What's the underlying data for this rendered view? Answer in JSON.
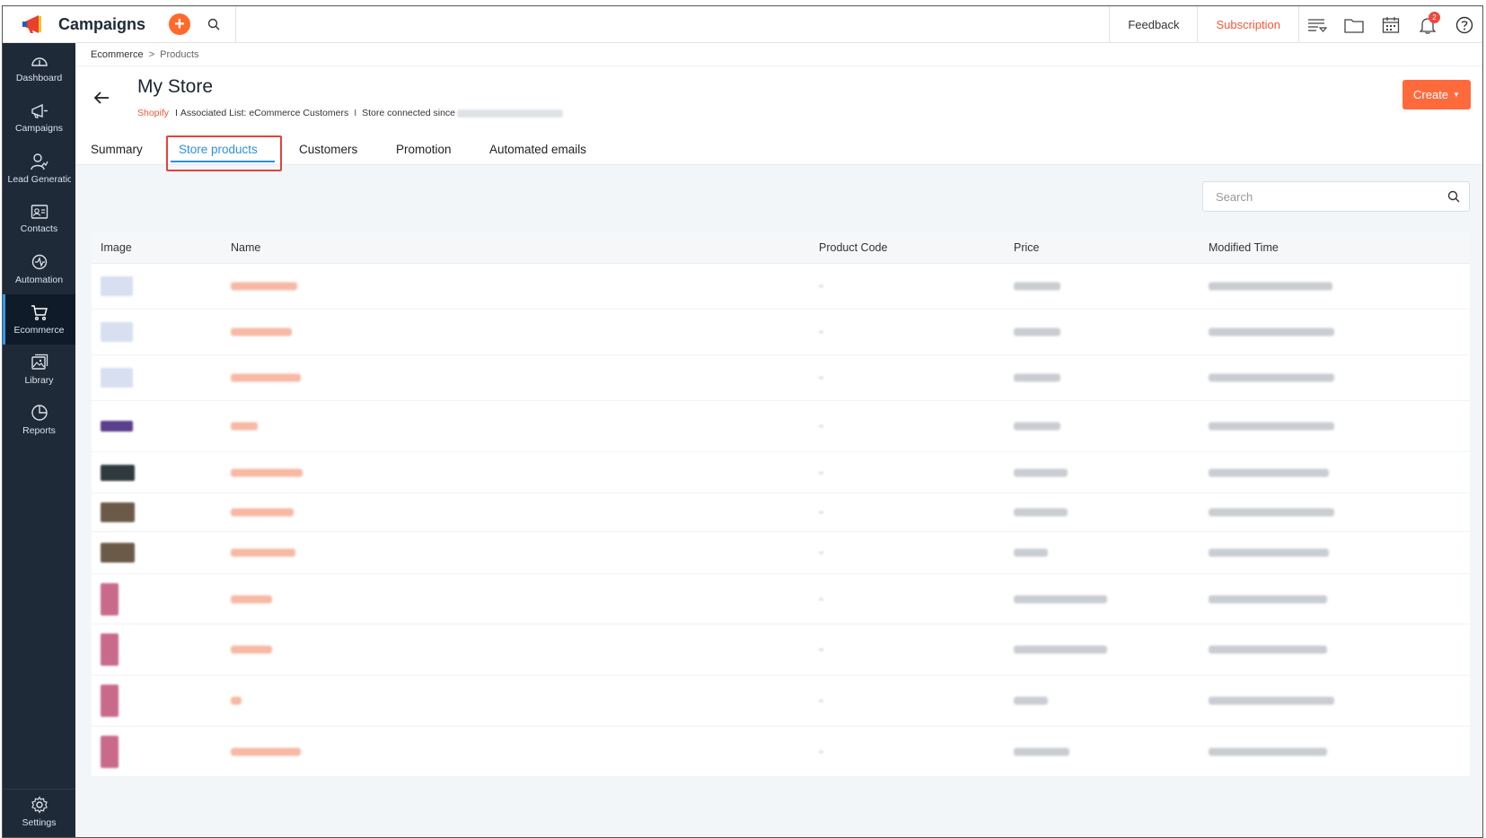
{
  "app": {
    "name": "Campaigns",
    "add_symbol": "+",
    "brand_color": "#e8412e"
  },
  "topbar": {
    "feedback_label": "Feedback",
    "subscription_label": "Subscription",
    "notification_count": "2",
    "icons": [
      "search-icon",
      "list-filter-icon",
      "folder-icon",
      "calendar-icon",
      "bell-icon",
      "help-icon"
    ]
  },
  "sidebar": {
    "items": [
      {
        "label": "Dashboard",
        "icon": "dashboard-icon"
      },
      {
        "label": "Campaigns",
        "icon": "megaphone-icon"
      },
      {
        "label": "Lead Generation",
        "icon": "lead-gen-icon"
      },
      {
        "label": "Contacts",
        "icon": "contacts-icon"
      },
      {
        "label": "Automation",
        "icon": "automation-icon"
      },
      {
        "label": "Ecommerce",
        "icon": "cart-icon",
        "active": true
      },
      {
        "label": "Library",
        "icon": "library-icon"
      },
      {
        "label": "Reports",
        "icon": "reports-icon"
      }
    ],
    "settings_label": "Settings"
  },
  "breadcrumb": {
    "parent": "Ecommerce",
    "separator": ">",
    "current": "Products"
  },
  "store": {
    "title": "My Store",
    "platform": "Shopify",
    "pipe": "I",
    "associated_list": "Associated List: eCommerce Customers",
    "connected_since": "Store connected since"
  },
  "create_button": {
    "label": "Create",
    "caret": "▼"
  },
  "tabs": [
    {
      "label": "Summary"
    },
    {
      "label": "Store products",
      "active": true
    },
    {
      "label": "Customers"
    },
    {
      "label": "Promotion"
    },
    {
      "label": "Automated emails"
    }
  ],
  "search": {
    "placeholder": "Search"
  },
  "table": {
    "columns": [
      "Image",
      "Name",
      "Product Code",
      "Price",
      "Modified Time"
    ],
    "row_count_visible": 11
  },
  "colors": {
    "accent": "#ff6a3d",
    "active_tab": "#2e8fe0",
    "sidebar_bg": "#1e2a38",
    "highlight": "#e0453a"
  }
}
